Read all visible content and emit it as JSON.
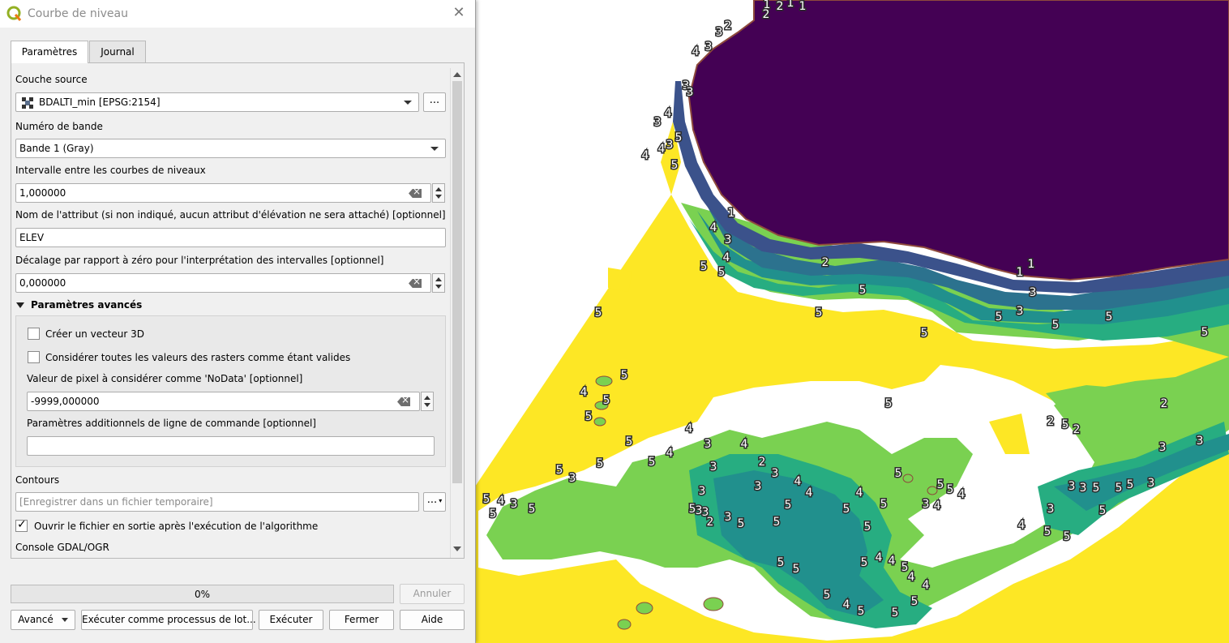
{
  "window": {
    "title": "Courbe de niveau"
  },
  "tabs": [
    {
      "label": "Paramètres",
      "active": true
    },
    {
      "label": "Journal",
      "active": false
    }
  ],
  "params": {
    "source_layer": {
      "label": "Couche source",
      "value": "BDALTI_min [EPSG:2154]",
      "button": "..."
    },
    "band": {
      "label": "Numéro de bande",
      "value": "Bande 1 (Gray)"
    },
    "interval": {
      "label": "Intervalle entre les courbes de niveaux",
      "value": "1,000000"
    },
    "attribute": {
      "label": "Nom de l'attribut (si non indiqué, aucun attribut d'élévation ne sera attaché) [optionnel]",
      "value": "ELEV"
    },
    "offset": {
      "label": "Décalage par rapport à zéro pour l'interprétation des intervalles [optionnel]",
      "value": "0,000000"
    },
    "advanced": {
      "label": "Paramètres avancés",
      "create_3d": {
        "label": "Créer un vecteur 3D",
        "checked": false
      },
      "treat_all_valid": {
        "label": "Considérer toutes les valeurs des rasters comme étant valides",
        "checked": false
      },
      "nodata": {
        "label": "Valeur de pixel à considérer comme 'NoData' [optionnel]",
        "value": "-9999,000000"
      },
      "extra_args": {
        "label": "Paramètres additionnels de ligne de commande [optionnel]",
        "value": ""
      }
    },
    "contours": {
      "label": "Contours",
      "placeholder": "[Enregistrer dans un fichier temporaire]",
      "button": "..."
    },
    "open_output": {
      "label": "Ouvrir le fichier en sortie après l'exécution de l'algorithme",
      "checked": true
    },
    "console": {
      "label": "Console GDAL/OGR"
    }
  },
  "progress": {
    "value": 0,
    "text": "0%"
  },
  "buttons": {
    "cancel": "Annuler",
    "advanced": "Avancé",
    "batch": "Exécuter comme processus de lot...",
    "run": "Exécuter",
    "close": "Fermer",
    "help": "Aide"
  },
  "map": {
    "colors": {
      "water": "#440154",
      "level1": "#3b528b",
      "level2": "#2c728e",
      "level3": "#21908d",
      "level4": "#27ad81",
      "level5": "#7ad151",
      "shore": "#fde725",
      "edge": "#8e4a3c"
    },
    "contour_labels": [
      "1",
      "2",
      "2",
      "1",
      "1",
      "3",
      "2",
      "4",
      "3",
      "3",
      "3",
      "4",
      "3",
      "5",
      "3",
      "4",
      "4",
      "5",
      "1",
      "4",
      "3",
      "4",
      "5",
      "5",
      "2",
      "1",
      "1",
      "5",
      "3",
      "3",
      "5",
      "5",
      "5",
      "5",
      "5",
      "5",
      "5",
      "5",
      "4",
      "5",
      "5",
      "4",
      "3",
      "4",
      "2",
      "3",
      "3",
      "3",
      "4",
      "4",
      "4",
      "5",
      "5",
      "5",
      "5",
      "5",
      "5",
      "4",
      "3",
      "4",
      "4",
      "5",
      "3",
      "3",
      "3",
      "5",
      "5",
      "5",
      "5",
      "3",
      "2",
      "5",
      "2",
      "2",
      "3",
      "3",
      "3",
      "3",
      "5",
      "3",
      "2",
      "3",
      "5",
      "5",
      "5",
      "5",
      "5",
      "4",
      "4",
      "5",
      "4",
      "4",
      "5",
      "4",
      "5",
      "5",
      "5",
      "5",
      "5",
      "5",
      "4",
      "5",
      "5",
      "5",
      "5",
      "3",
      "5",
      "4",
      "3",
      "5",
      "5"
    ]
  }
}
